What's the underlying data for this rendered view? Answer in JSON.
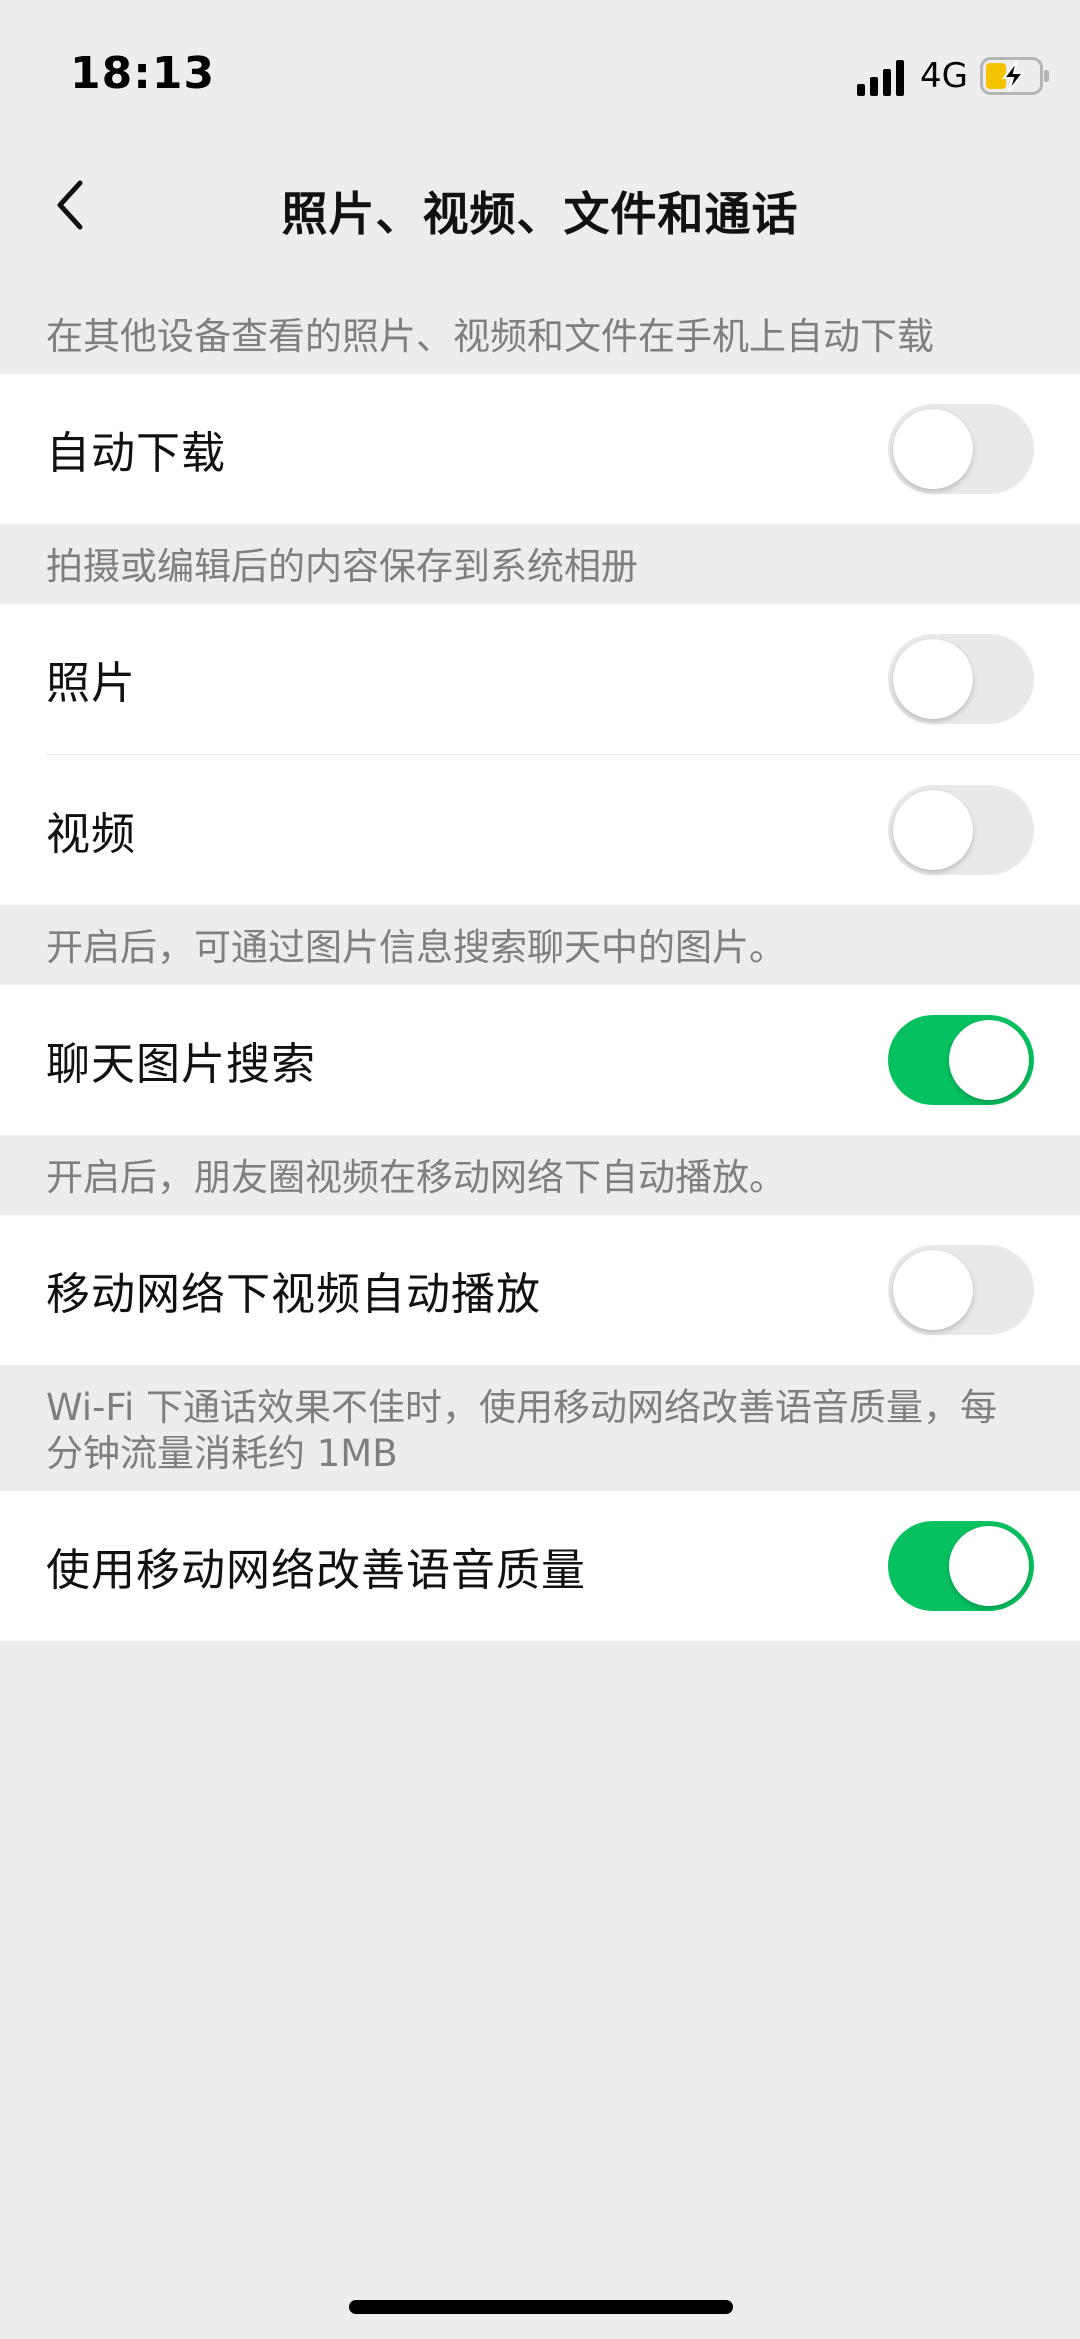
{
  "status_bar": {
    "time": "18:13",
    "network": "4G",
    "icons": [
      "signal-icon",
      "battery-charging-icon"
    ]
  },
  "nav": {
    "title": "照片、视频、文件和通话",
    "back_icon": "chevron-left-icon"
  },
  "sections": [
    {
      "caption": "在其他设备查看的照片、视频和文件在手机上自动下载",
      "items": [
        {
          "label": "自动下载",
          "enabled": false
        }
      ]
    },
    {
      "caption": "拍摄或编辑后的内容保存到系统相册",
      "items": [
        {
          "label": "照片",
          "enabled": false
        },
        {
          "label": "视频",
          "enabled": false
        }
      ]
    },
    {
      "caption": "开启后，可通过图片信息搜索聊天中的图片。",
      "items": [
        {
          "label": "聊天图片搜索",
          "enabled": true
        }
      ]
    },
    {
      "caption": "开启后，朋友圈视频在移动网络下自动播放。",
      "items": [
        {
          "label": "移动网络下视频自动播放",
          "enabled": false
        }
      ]
    },
    {
      "caption": "Wi-Fi 下通话效果不佳时，使用移动网络改善语音质量，每分钟流量消耗约 1MB",
      "items": [
        {
          "label": "使用移动网络改善语音质量",
          "enabled": true
        }
      ]
    }
  ],
  "colors": {
    "background": "#ededed",
    "toggle_on": "#07c160",
    "toggle_off": "#e9e9ea",
    "caption_text": "#7f7f7f"
  }
}
